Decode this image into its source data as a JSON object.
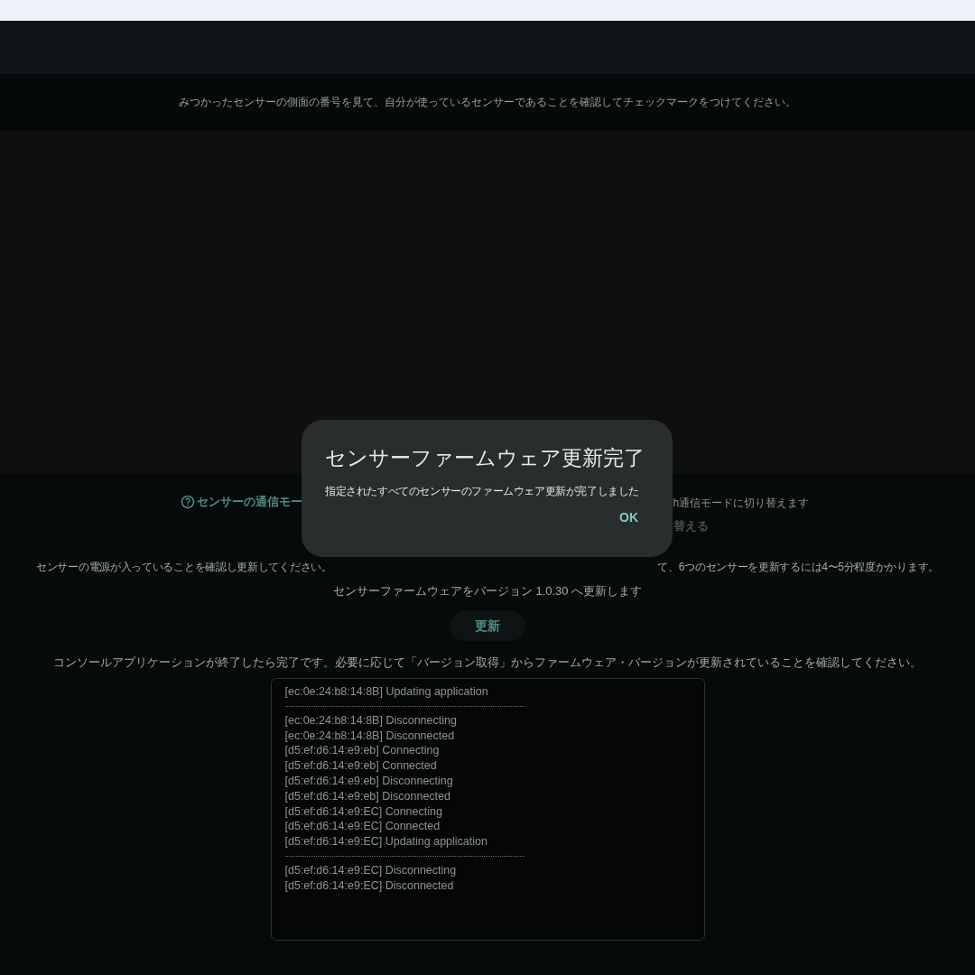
{
  "header_notice": "みつかったセンサーの側面の番号を見て、自分が使っているセンサーであることを確認してチェックマークをつけてください。",
  "help_link": "センサーの通信モー",
  "mode_note": "h通信モードに切り替えます",
  "mode_button": "替える",
  "power_note_start": "センサーの電源が入っていることを確認し更新してください。",
  "power_note_end": "て、6つのセンサーを更新するには4〜5分程度かかります。",
  "version_note": "センサーファームウェアをバージョン 1.0.30 へ更新します",
  "update_button": "更新",
  "completion_note": "コンソールアプリケーションが終了したら完了です。必要に応じて「バージョン取得」からファームウェア・バージョンが更新されていることを確認してください。",
  "log": [
    {
      "kind": "line",
      "text": "[ec:0e:24:b8:14:8B] Updating application"
    },
    {
      "kind": "separator"
    },
    {
      "kind": "line",
      "text": "[ec:0e:24:b8:14:8B] Disconnecting"
    },
    {
      "kind": "line",
      "text": "[ec:0e:24:b8:14:8B] Disconnected"
    },
    {
      "kind": "line",
      "text": "[d5:ef:d6:14:e9:eb] Connecting"
    },
    {
      "kind": "line",
      "text": "[d5:ef:d6:14:e9:eb] Connected"
    },
    {
      "kind": "line",
      "text": "[d5:ef:d6:14:e9:eb] Disconnecting"
    },
    {
      "kind": "line",
      "text": "[d5:ef:d6:14:e9:eb] Disconnected"
    },
    {
      "kind": "line",
      "text": "[d5:ef:d6:14:e9:EC] Connecting"
    },
    {
      "kind": "line",
      "text": "[d5:ef:d6:14:e9:EC] Connected"
    },
    {
      "kind": "line",
      "text": "[d5:ef:d6:14:e9:EC] Updating application"
    },
    {
      "kind": "separator"
    },
    {
      "kind": "line",
      "text": "[d5:ef:d6:14:e9:EC] Disconnecting"
    },
    {
      "kind": "line",
      "text": "[d5:ef:d6:14:e9:EC] Disconnected"
    }
  ],
  "dialog": {
    "title": "センサーファームウェア更新完了",
    "message": "指定されたすべてのセンサーのファームウェア更新が完了しました",
    "buttons": [
      "OK"
    ]
  }
}
